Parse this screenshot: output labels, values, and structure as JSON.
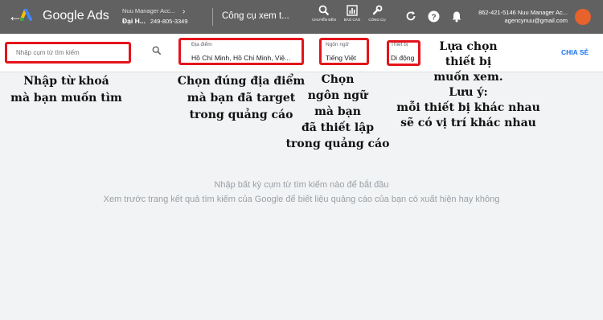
{
  "header": {
    "back_icon": "arrow-left-icon",
    "app_name": "Google Ads",
    "account_manager": "Nuu Manager Acc...",
    "account_name": "Đại H...",
    "account_id": "249-805-3349",
    "tool_title": "Công cụ xem t...",
    "nav_buttons": [
      {
        "label": "CHUYỂN ĐẾN",
        "icon": "search-icon"
      },
      {
        "label": "BÁO CÁO",
        "icon": "bar-chart-icon"
      },
      {
        "label": "CÔNG CỤ",
        "icon": "wrench-icon"
      }
    ],
    "customer_id": "862-421-5146 Nuu Manager Ac...",
    "email": "agencynuu@gmail.com",
    "colors": {
      "bar": "#616161",
      "avatar": "#e8622c"
    }
  },
  "filters": {
    "search_placeholder": "Nhập cụm từ tìm kiếm",
    "location_label": "Địa điểm",
    "location_value": "Hồ Chí Minh, Hồ Chí Minh, Việ...",
    "language_label": "Ngôn ngữ",
    "language_value": "Tiếng Việt",
    "device_label": "Thiết bị",
    "device_value": "Di động",
    "share_label": "CHIA SẺ"
  },
  "annotations": {
    "search_note": [
      "Nhập từ khoá",
      "mà bạn muốn tìm"
    ],
    "location_note": [
      "Chọn đúng địa điểm",
      "mà bạn đã target",
      "trong quảng cáo"
    ],
    "language_note": [
      "Chọn",
      "ngôn ngữ",
      "mà bạn",
      "đã thiết lập",
      "trong quảng cáo"
    ],
    "device_note": [
      "Lựa chọn",
      "thiết bị",
      "muốn xem.",
      "Lưu ý:",
      "mỗi thiết bị khác nhau",
      "sẽ có vị trí khác nhau"
    ],
    "highlight_color": "#e4141c"
  },
  "empty_state": {
    "title": "Nhập bất kỳ cụm từ tìm kiếm nào để bắt đầu",
    "subtitle": "Xem trước trang kết quả tìm kiếm của Google để biết liệu quảng cáo của bạn có xuất hiện hay không"
  }
}
